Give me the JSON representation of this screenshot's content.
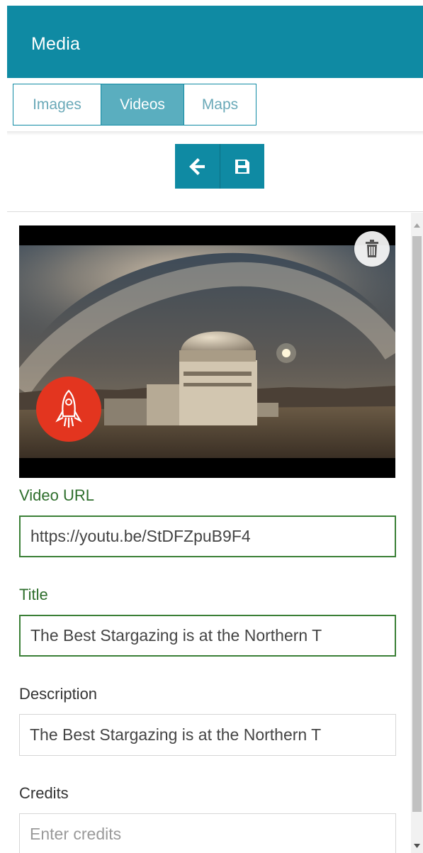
{
  "header": {
    "title": "Media"
  },
  "tabs": [
    {
      "label": "Images",
      "active": false
    },
    {
      "label": "Videos",
      "active": true
    },
    {
      "label": "Maps",
      "active": false
    }
  ],
  "toolbar": {
    "back_icon": "arrow-left-icon",
    "save_icon": "floppy-disk-icon"
  },
  "video": {
    "thumbnail": "observatory-milky-way-night-sky",
    "channel_logo": "rocket-icon",
    "delete_icon": "trash-icon"
  },
  "form": {
    "video_url": {
      "label": "Video URL",
      "value": "https://youtu.be/StDFZpuB9F4"
    },
    "title": {
      "label": "Title",
      "value": "The Best Stargazing is at the Northern T"
    },
    "description": {
      "label": "Description",
      "value": "The Best Stargazing is at the Northern T"
    },
    "credits": {
      "label": "Credits",
      "value": "",
      "placeholder": "Enter credits"
    }
  },
  "colors": {
    "brand": "#0f8aa3",
    "tab_active": "#5aaebf",
    "label_active": "#2e6e2c",
    "logo_red": "#e3351f"
  }
}
